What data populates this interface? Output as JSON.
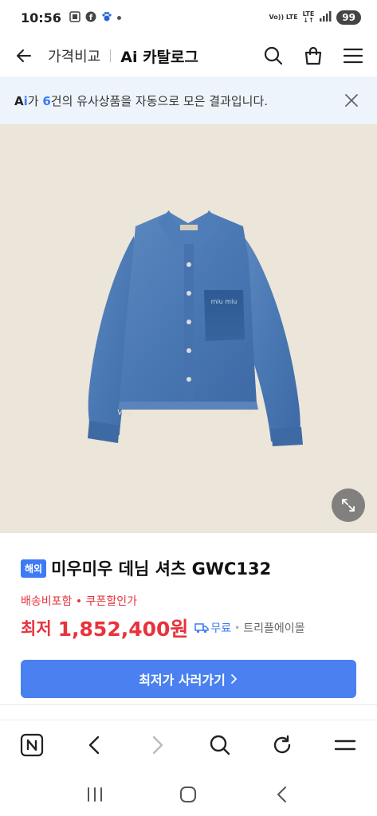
{
  "status_bar": {
    "time": "10:56",
    "network_top": "Vo)) LTE",
    "network_bottom": "LTE",
    "battery": "99"
  },
  "header": {
    "subtitle": "가격비교",
    "title": "Ai 카탈로그"
  },
  "banner": {
    "ai_prefix": "A",
    "ai_suffix": "i",
    "text_before": "가 ",
    "count": "6",
    "text_after": "건의 유사상품을 자동으로 모은 결과입니다."
  },
  "product": {
    "badge": "해외",
    "title": "미우미우 데님 셔츠 GWC132",
    "benefits": "배송비포함 • 쿠폰할인가",
    "price_label": "최저",
    "price": "1,852,400원",
    "shipping": "무료",
    "mall": "트리플에이몰",
    "buy_button": "최저가 사러가기",
    "pocket_logo": "miu miu"
  },
  "colors": {
    "accent_blue": "#3d7bf5",
    "button_blue": "#4a80f0",
    "price_red": "#e8323c",
    "banner_bg": "#eef4fb",
    "image_bg": "#ece5d9"
  },
  "icons": {
    "back": "arrow-left-icon",
    "search": "search-icon",
    "cart": "shopping-bag-icon",
    "menu": "hamburger-menu-icon",
    "close": "close-icon",
    "zoom": "expand-icon"
  }
}
